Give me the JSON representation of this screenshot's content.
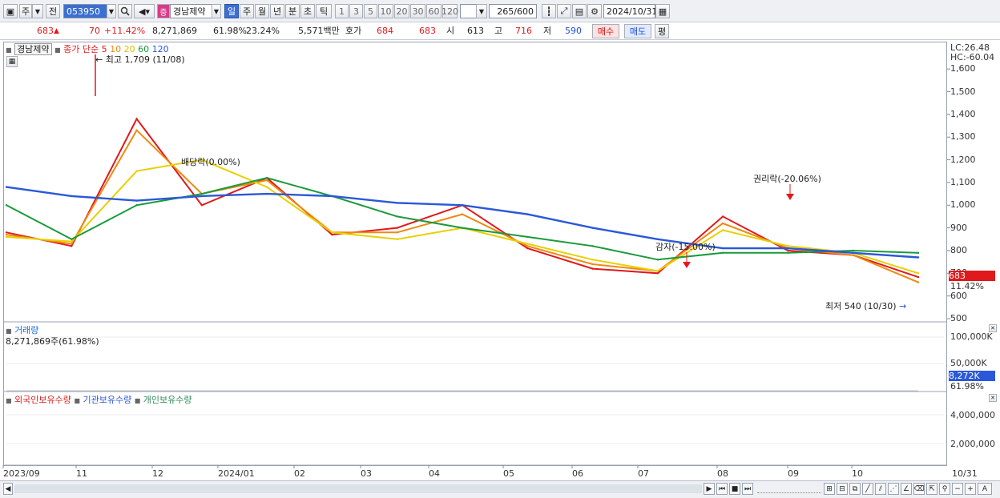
{
  "toolbar": {
    "period_main": "주",
    "prev_label": "전",
    "code": "053950",
    "badge": "증",
    "name": "경남제약",
    "tabs": [
      "일",
      "주",
      "월",
      "년",
      "분",
      "초",
      "틱"
    ],
    "interval_buttons": [
      "1",
      "3",
      "5",
      "10",
      "20",
      "30",
      "60",
      "120"
    ],
    "count": "265",
    "count_max": "/600",
    "date": "2024/10/31"
  },
  "quote": {
    "price": "683",
    "change": "70",
    "change_pct": "+11.42%",
    "volume": "8,271,869",
    "vol_ratio": "61.98%",
    "turnover": "23.24%",
    "amount": "5,571백만",
    "ask_label": "호가",
    "ask": "684",
    "bid": "683",
    "open_label": "시",
    "open": "613",
    "high_label": "고",
    "high": "716",
    "low_label": "저",
    "low": "590",
    "buy": "매수",
    "sell": "매도",
    "avg": "평"
  },
  "legend": {
    "name": "경남제약",
    "type": "종가 단순",
    "ma": [
      "5",
      "10",
      "20",
      "60",
      "120"
    ],
    "ma_colors": [
      "#e0191c",
      "#ee8a12",
      "#e8d000",
      "#1a9a3a",
      "#2a58d8"
    ]
  },
  "annotations": {
    "high": "최고 1,709 (11/08)",
    "low": "최저 540 (10/30)",
    "ex_div": "배당락(0.00%)",
    "ex_rights": "권리락(-20.06%)",
    "capital_reduction": "감자(-15.00%)",
    "lc": "LC:26.48",
    "hc": "HC:-60.04",
    "last_price": "683",
    "last_pct": "11.42%"
  },
  "volume_panel": {
    "title": "거래량",
    "value": "8,271,869주(61.98%)",
    "axis": [
      "100,000K",
      "50,000K"
    ],
    "last": "8,272K",
    "last_pct": "61.98%"
  },
  "holding_panel": {
    "series": [
      "외국인보유수량",
      "기관보유수량",
      "개인보유수량"
    ],
    "colors": [
      "#d81e1e",
      "#2a58d8",
      "#2e8b57"
    ],
    "axis": [
      "4,000,000",
      "2,000,000"
    ]
  },
  "price_axis": [
    "1,600",
    "1,500",
    "1,400",
    "1,300",
    "1,200",
    "1,100",
    "1,000",
    "900",
    "800",
    "700",
    "600",
    "500"
  ],
  "x_axis": [
    "2023/09",
    "11",
    "12",
    "2024/01",
    "02",
    "03",
    "04",
    "05",
    "06",
    "07",
    "08",
    "09",
    "10",
    "10/31"
  ],
  "chart_data": {
    "type": "line",
    "title": "경남제약",
    "x": [
      "2023/09",
      "10",
      "11",
      "12",
      "2024/01",
      "02",
      "03",
      "04",
      "05",
      "06",
      "07",
      "08",
      "09",
      "10",
      "10/31"
    ],
    "series": [
      {
        "name": "5",
        "values": [
          880,
          820,
          1380,
          1000,
          1120,
          870,
          900,
          1000,
          810,
          720,
          700,
          950,
          800,
          780,
          683
        ]
      },
      {
        "name": "10",
        "values": [
          870,
          830,
          1330,
          1050,
          1110,
          880,
          880,
          960,
          820,
          740,
          710,
          920,
          810,
          780,
          660
        ]
      },
      {
        "name": "20",
        "values": [
          860,
          840,
          1150,
          1200,
          1080,
          880,
          850,
          900,
          830,
          760,
          710,
          890,
          820,
          790,
          700
        ]
      },
      {
        "name": "60",
        "values": [
          1000,
          850,
          1000,
          1050,
          1120,
          1040,
          950,
          900,
          860,
          820,
          760,
          790,
          790,
          800,
          790
        ]
      },
      {
        "name": "120",
        "values": [
          1080,
          1040,
          1020,
          1040,
          1050,
          1040,
          1010,
          1000,
          960,
          900,
          850,
          810,
          810,
          790,
          770
        ]
      }
    ],
    "ylim": [
      500,
      1650
    ],
    "high": 1709,
    "low": 540
  }
}
